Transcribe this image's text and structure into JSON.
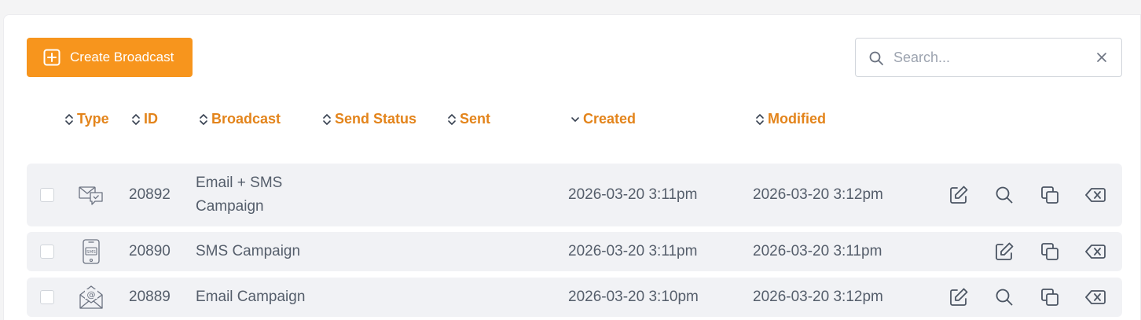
{
  "toolbar": {
    "create_label": "Create Broadcast",
    "search_placeholder": "Search...",
    "search_value": ""
  },
  "columns": {
    "type": "Type",
    "id": "ID",
    "broadcast": "Broadcast",
    "send_status": "Send Status",
    "sent": "Sent",
    "created": "Created",
    "modified": "Modified"
  },
  "rows": [
    {
      "type_icon": "email-sms-icon",
      "id": "20892",
      "name_line1": "Email + SMS",
      "name_line2": "Campaign",
      "send_status": "",
      "sent": "",
      "created": "2026-03-20 3:11pm",
      "modified": "2026-03-20 3:12pm",
      "actions": [
        "edit",
        "view",
        "duplicate",
        "delete"
      ]
    },
    {
      "type_icon": "sms-icon",
      "id": "20890",
      "name": "SMS Campaign",
      "send_status": "",
      "sent": "",
      "created": "2026-03-20 3:11pm",
      "modified": "2026-03-20 3:11pm",
      "actions": [
        "edit",
        "duplicate",
        "delete"
      ]
    },
    {
      "type_icon": "email-icon",
      "id": "20889",
      "name": "Email Campaign",
      "send_status": "",
      "sent": "",
      "created": "2026-03-20 3:10pm",
      "modified": "2026-03-20 3:12pm",
      "actions": [
        "edit",
        "view",
        "duplicate",
        "delete"
      ]
    }
  ],
  "colors": {
    "accent": "#f7951d",
    "header_text": "#e3841b",
    "row_bg": "#f1f2f5",
    "text": "#555e6b"
  }
}
